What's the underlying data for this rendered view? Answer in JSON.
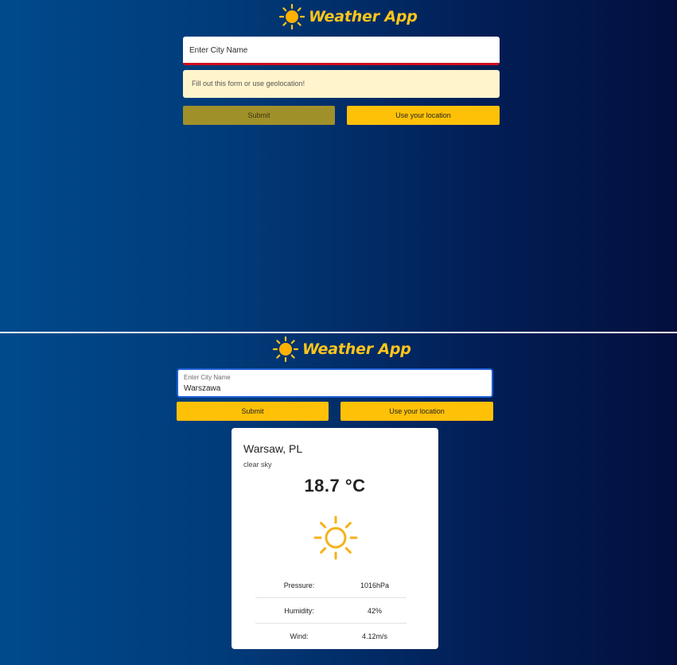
{
  "app": {
    "title": "Weather App"
  },
  "top_state": {
    "city_input": {
      "placeholder": "Enter City Name"
    },
    "alert": "Fill out this form or use geolocation!",
    "submit_label": "Submit",
    "location_label": "Use your location"
  },
  "bottom_state": {
    "city_input": {
      "label": "Enter City Name",
      "value": "Warszawa"
    },
    "submit_label": "Submit",
    "location_label": "Use your location",
    "weather": {
      "city": "Warsaw, PL",
      "description": "clear sky",
      "temperature": "18.7 °C",
      "icon": "sun-icon",
      "stats": [
        {
          "label": "Pressure:",
          "value": "1016hPa"
        },
        {
          "label": "Humidity:",
          "value": "42%"
        },
        {
          "label": "Wind:",
          "value": "4.12m/s"
        }
      ]
    }
  },
  "colors": {
    "accent": "#ffc61a",
    "button": "#ffc107",
    "button_disabled": "#a0902a",
    "error_underline": "#d00a1d",
    "focus_border": "#1f5fd6",
    "alert_bg": "#fff4cc"
  }
}
